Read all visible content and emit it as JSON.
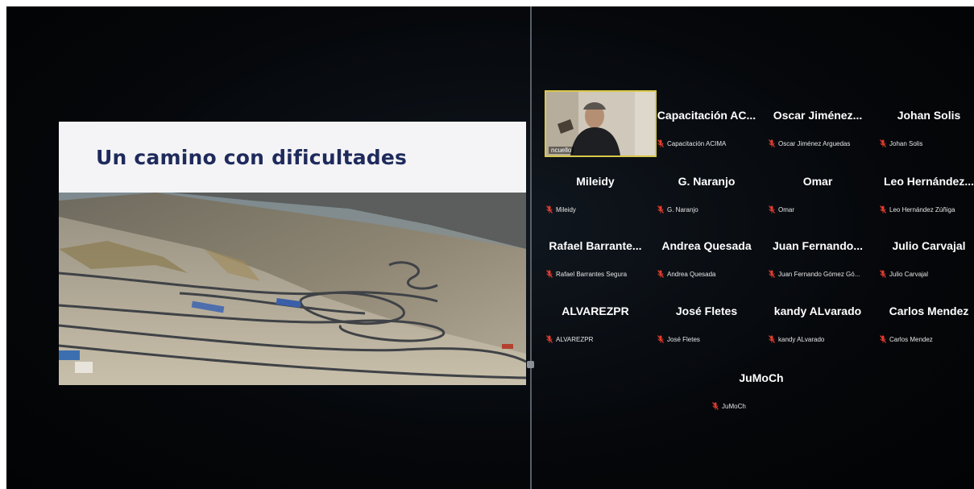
{
  "slide": {
    "title": "Un camino con dificultades"
  },
  "active_speaker": {
    "label": "ncuello"
  },
  "participants": [
    {
      "display": "Capacitación AC...",
      "full": "Capacitación ACIMA"
    },
    {
      "display": "Oscar Jiménez...",
      "full": "Oscar Jiménez Arguedas"
    },
    {
      "display": "Johan Solis",
      "full": "Johan Solis"
    },
    {
      "display": "Mileidy",
      "full": "Mileidy"
    },
    {
      "display": "G. Naranjo",
      "full": "G. Naranjo"
    },
    {
      "display": "Omar",
      "full": "Omar"
    },
    {
      "display": "Leo Hernández...",
      "full": "Leo Hernández Zúñiga"
    },
    {
      "display": "Rafael Barrante...",
      "full": "Rafael Barrantes Segura"
    },
    {
      "display": "Andrea Quesada",
      "full": "Andrea Quesada"
    },
    {
      "display": "Juan Fernando...",
      "full": "Juan Fernando Gómez Gó..."
    },
    {
      "display": "Julio Carvajal",
      "full": "Julio Carvajal"
    },
    {
      "display": "ALVAREZPR",
      "full": "ALVAREZPR"
    },
    {
      "display": "José Fletes",
      "full": "José Fletes"
    },
    {
      "display": "kandy ALvarado",
      "full": "kandy ALvarado"
    },
    {
      "display": "Carlos Mendez",
      "full": "Carlos Mendez"
    },
    {
      "display": "JuMoCh",
      "full": "JuMoCh"
    }
  ],
  "colors": {
    "mic_muted": "#e23b2e",
    "speaker_border": "#d9c84a",
    "slide_title": "#1f2a5c"
  },
  "icons": {
    "mic_muted": "mic-muted-icon"
  }
}
